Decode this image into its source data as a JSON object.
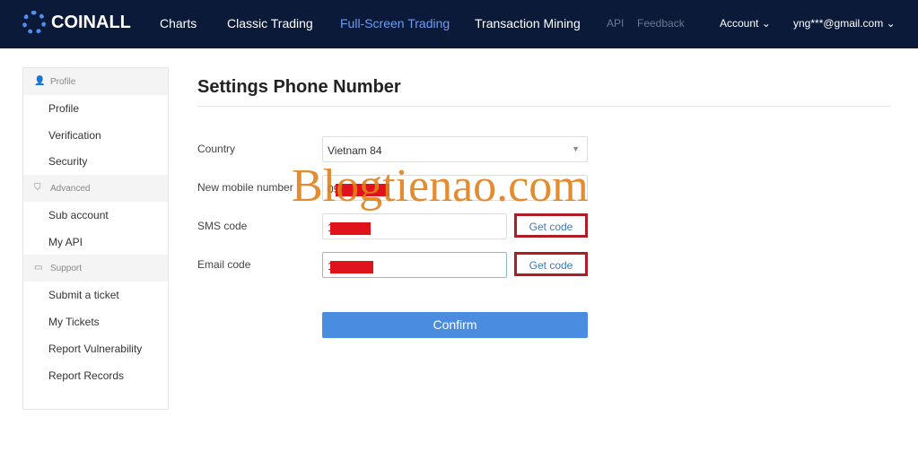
{
  "nav": {
    "logo": "COINALL",
    "links": [
      "Charts",
      "Classic Trading",
      "Full-Screen Trading",
      "Transaction Mining"
    ],
    "small": [
      "API",
      "Feedback"
    ],
    "account": "Account",
    "email": "yng***@gmail.com",
    "active_color": "#6e9cf0"
  },
  "sidebar": {
    "sections": [
      {
        "header": "Profile",
        "items": [
          "Profile",
          "Verification",
          "Security"
        ]
      },
      {
        "header": "Advanced",
        "items": [
          "Sub account",
          "My API"
        ]
      },
      {
        "header": "Support",
        "items": [
          "Submit a ticket",
          "My Tickets",
          "Report Vulnerability",
          "Report Records"
        ]
      }
    ]
  },
  "form": {
    "title": "Settings Phone Number",
    "country_label": "Country",
    "country_value": "Vietnam 84",
    "mobile_label": "New mobile number",
    "mobile_value": "09",
    "sms_label": "SMS code",
    "sms_value": "1",
    "email_label": "Email code",
    "email_value": "1",
    "get_code": "Get code",
    "confirm": "Confirm"
  },
  "watermark": "Blogtienao.com"
}
